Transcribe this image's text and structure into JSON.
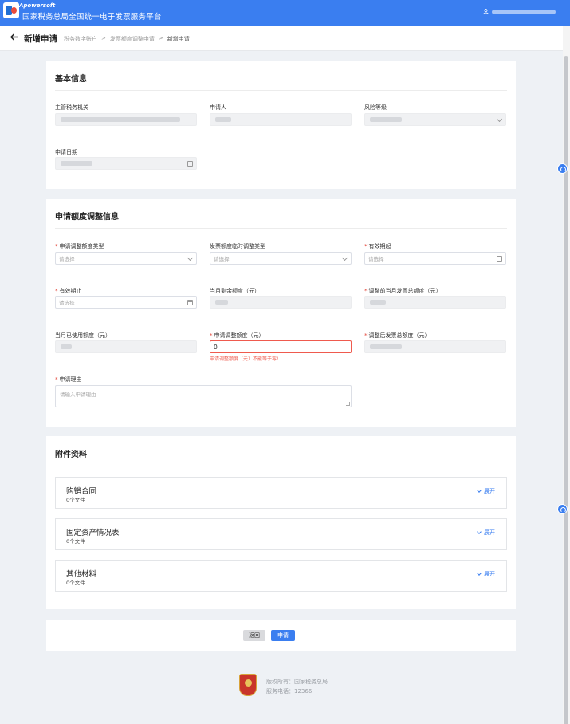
{
  "header": {
    "watermark": "Apowersoft",
    "site_title": "国家税务总局全国统一电子发票服务平台",
    "user_icon": "user-icon"
  },
  "subbar": {
    "page_title": "新增申请",
    "breadcrumb": [
      "税务数字账户",
      ">",
      "发票额度调整申请",
      ">",
      "新增申请"
    ]
  },
  "basic_info": {
    "title": "基本信息",
    "authority_label": "主管税务机关",
    "applicant_label": "申请人",
    "risk_label": "风险等级",
    "date_label": "申请日期"
  },
  "quota_info": {
    "title": "申请额度调整信息",
    "adjust_type_label": "申请调整额度类型",
    "adjust_type_placeholder": "请选择",
    "temp_type_label": "发票额度临时调整类型",
    "temp_type_placeholder": "请选择",
    "valid_start_label": "有效期起",
    "valid_start_placeholder": "请选择",
    "valid_end_label": "有效期止",
    "valid_end_placeholder": "请选择",
    "remaining_label": "当月剩余额度（元）",
    "total_before_label": "调整前当月发票总额度（元）",
    "used_label": "当月已使用额度（元）",
    "adjust_amount_label": "申请调整额度（元）",
    "adjust_amount_value": "0",
    "adjust_amount_error": "申请调整额度（元）不能等于零!",
    "total_after_label": "调整后发票总额度（元）",
    "reason_label": "申请理由",
    "reason_placeholder": "请输入申请理由"
  },
  "attachments": {
    "title": "附件资料",
    "items": [
      {
        "name": "购销合同",
        "count": "0个文件",
        "expand": "展开"
      },
      {
        "name": "固定资产情况表",
        "count": "0个文件",
        "expand": "展开"
      },
      {
        "name": "其他材料",
        "count": "0个文件",
        "expand": "展开"
      }
    ]
  },
  "actions": {
    "back_label": "返回",
    "submit_label": "申请"
  },
  "footer": {
    "copyright": "版权所有：国家税务总局",
    "hotline": "服务电话：12366"
  },
  "colors": {
    "primary": "#3a7ef0",
    "error": "#ef5a4e"
  }
}
